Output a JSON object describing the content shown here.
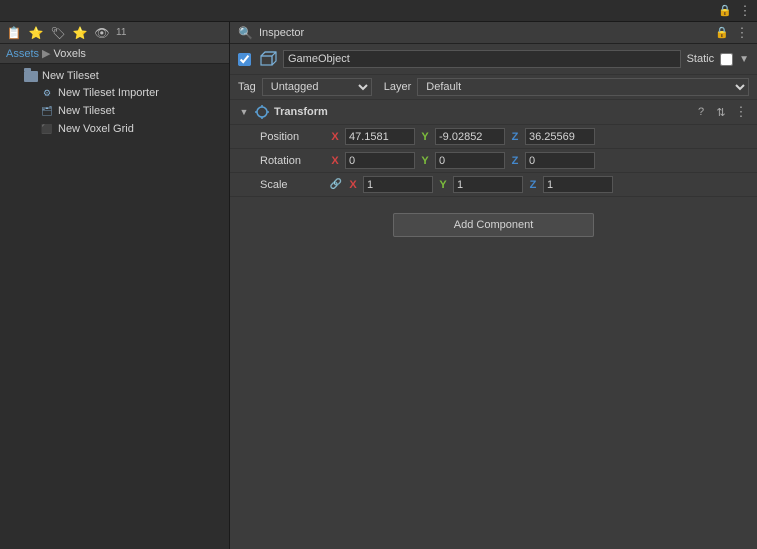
{
  "app": {
    "title": "Inspector"
  },
  "top_bar": {
    "lock_icon": "🔒",
    "menu_icon": "⋮"
  },
  "left_toolbar": {
    "icons": [
      "📋",
      "⭐",
      "🏷",
      "⭐",
      "👁"
    ],
    "count": "11"
  },
  "breadcrumb": {
    "assets": "Assets",
    "separator": "▶",
    "current": "Voxels"
  },
  "file_tree": [
    {
      "label": "New Tileset",
      "type": "folder",
      "indent": 0
    },
    {
      "label": "New Tileset Importer",
      "type": "script",
      "indent": 1
    },
    {
      "label": "New Tileset",
      "type": "tileset",
      "indent": 1
    },
    {
      "label": "New Voxel Grid",
      "type": "voxelgrid",
      "indent": 1
    }
  ],
  "inspector": {
    "title": "Inspector",
    "lock_icon": "🔒",
    "menu_icon": "⋮",
    "gameobject": {
      "checked": true,
      "name": "GameObject",
      "static_label": "Static",
      "static_checked": false
    },
    "tag": {
      "label": "Tag",
      "value": "Untagged"
    },
    "layer": {
      "label": "Layer",
      "value": "Default"
    },
    "transform": {
      "title": "Transform",
      "position": {
        "label": "Position",
        "x": "47.1581",
        "y": "-9.02852",
        "z": "36.25569"
      },
      "rotation": {
        "label": "Rotation",
        "x": "0",
        "y": "0",
        "z": "0"
      },
      "scale": {
        "label": "Scale",
        "x": "1",
        "y": "1",
        "z": "1"
      }
    },
    "add_component_label": "Add Component"
  }
}
